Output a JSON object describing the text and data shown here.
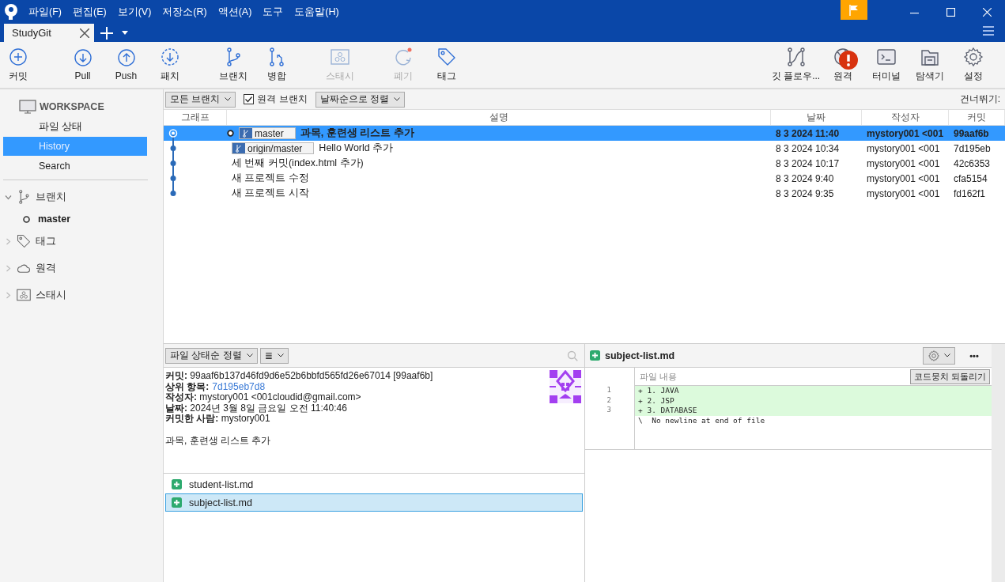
{
  "menu": [
    "파일(F)",
    "편집(E)",
    "보기(V)",
    "저장소(R)",
    "액션(A)",
    "도구",
    "도움말(H)"
  ],
  "tabs": [
    {
      "label": "StudyGit",
      "selected": true
    }
  ],
  "toolbar": {
    "left": [
      {
        "label": "커밋",
        "disabled": false
      },
      {
        "label": "Pull",
        "disabled": false
      },
      {
        "label": "Push",
        "disabled": false
      },
      {
        "label": "패치",
        "disabled": false
      },
      {
        "label": "브랜치",
        "disabled": false
      },
      {
        "label": "병합",
        "disabled": false
      },
      {
        "label": "스태시",
        "disabled": true
      },
      {
        "label": "폐기",
        "disabled": true
      },
      {
        "label": "태그",
        "disabled": false
      }
    ],
    "right": [
      {
        "label": "깃 플로우...",
        "alert": false
      },
      {
        "label": "원격",
        "alert": true
      },
      {
        "label": "터미널",
        "alert": false
      },
      {
        "label": "탐색기",
        "alert": false
      },
      {
        "label": "설정",
        "alert": false
      }
    ]
  },
  "sidebar": {
    "workspace": "WORKSPACE",
    "items": [
      {
        "label": "파일 상태",
        "selected": false
      },
      {
        "label": "History",
        "selected": true
      },
      {
        "label": "Search",
        "selected": false
      }
    ],
    "sections": [
      {
        "label": "브랜치",
        "expanded": true,
        "children": [
          {
            "label": "master",
            "current": true
          }
        ]
      },
      {
        "label": "태그",
        "expanded": false
      },
      {
        "label": "원격",
        "expanded": false
      },
      {
        "label": "스태시",
        "expanded": false
      }
    ]
  },
  "filter_bar": {
    "branch_dropdown": "모든 브랜치",
    "remote_branches": {
      "label": "원격 브랜치",
      "checked": true
    },
    "sort_dropdown": "날짜순으로 정렬",
    "skip_label": "건너뛰기:"
  },
  "table": {
    "columns": [
      "그래프",
      "설명",
      "날짜",
      "작성자",
      "커밋"
    ],
    "rows": [
      {
        "head": true,
        "refs": [
          "master"
        ],
        "description": "과목, 훈련생 리스트 추가",
        "date": "8 3 2024 11:40",
        "author": "mystory001 <001",
        "commit": "99aaf6b",
        "selected": true
      },
      {
        "head": false,
        "refs": [
          "origin/master"
        ],
        "description": "Hello World 추가",
        "date": "8 3 2024 10:34",
        "author": "mystory001 <001",
        "commit": "7d195eb",
        "selected": false
      },
      {
        "head": false,
        "refs": [],
        "description": "세 번째 커밋(index.html 추가)",
        "date": "8 3 2024 10:17",
        "author": "mystory001 <001",
        "commit": "42c6353",
        "selected": false
      },
      {
        "head": false,
        "refs": [],
        "description": "새 프로젝트 수정",
        "date": "8 3 2024 9:40",
        "author": "mystory001 <001",
        "commit": "cfa5154",
        "selected": false
      },
      {
        "head": false,
        "refs": [],
        "description": "새 프로젝트 시작",
        "date": "8 3 2024 9:35",
        "author": "mystory001 <001",
        "commit": "fd162f1",
        "selected": false
      }
    ]
  },
  "details": {
    "sort_dropdown": "파일 상태순 정렬",
    "view_dropdown": "≣",
    "info": [
      {
        "text": "**커밋:** 99aaf6b137d46fd9d6e52b6bbfd565fd26e67014 [99aaf6b]"
      },
      {
        "text": "**상위 항목:**",
        "link": "7d195eb7d8"
      },
      {
        "text": "**작성자:** mystory001 <001cloudid@gmail.com>"
      },
      {
        "text": "**날짜:** 2024년 3월 8일 금요일 오전 11:40:46"
      },
      {
        "text": "**커밋한 사람:** mystory001"
      }
    ],
    "message": "과목, 훈련생 리스트 추가",
    "files": [
      {
        "name": "student-list.md",
        "selected": false
      },
      {
        "name": "subject-list.md",
        "selected": true
      }
    ]
  },
  "diff": {
    "file": "subject-list.md",
    "more": "•••",
    "header": "파일 내용",
    "revert_button": "코드뭉치 되돌리기",
    "lines": [
      {
        "number": "1",
        "text": "+ 1. JAVA",
        "kind": "added"
      },
      {
        "number": "2",
        "text": "+ 2. JSP",
        "kind": "added"
      },
      {
        "number": "3",
        "text": "+ 3. DATABASE",
        "kind": "added"
      },
      {
        "text": "\\  No newline at end of file",
        "kind": "context"
      }
    ]
  }
}
